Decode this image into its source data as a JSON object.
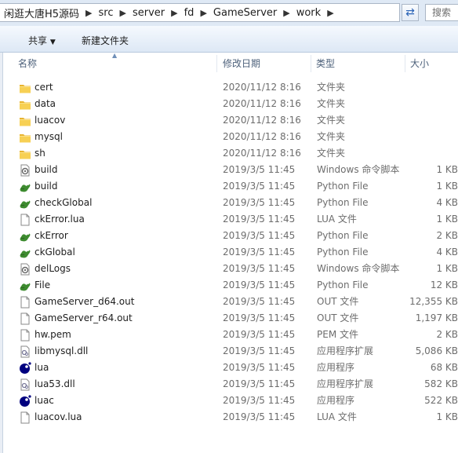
{
  "breadcrumb": [
    "闲逛大唐H5源码",
    "src",
    "server",
    "fd",
    "GameServer",
    "work"
  ],
  "search_placeholder": "搜索",
  "toolbar": {
    "share_label": "共享",
    "new_folder_label": "新建文件夹"
  },
  "columns": {
    "name": "名称",
    "date": "修改日期",
    "type": "类型",
    "size": "大小"
  },
  "files": [
    {
      "name": "cert",
      "date": "2020/11/12 8:16",
      "type": "文件夹",
      "size": "",
      "icon": "folder-icon"
    },
    {
      "name": "data",
      "date": "2020/11/12 8:16",
      "type": "文件夹",
      "size": "",
      "icon": "folder-icon"
    },
    {
      "name": "luacov",
      "date": "2020/11/12 8:16",
      "type": "文件夹",
      "size": "",
      "icon": "folder-icon"
    },
    {
      "name": "mysql",
      "date": "2020/11/12 8:16",
      "type": "文件夹",
      "size": "",
      "icon": "folder-icon"
    },
    {
      "name": "sh",
      "date": "2020/11/12 8:16",
      "type": "文件夹",
      "size": "",
      "icon": "folder-icon"
    },
    {
      "name": "build",
      "date": "2019/3/5 11:45",
      "type": "Windows 命令脚本",
      "size": "1 KB",
      "icon": "batch-file-icon"
    },
    {
      "name": "build",
      "date": "2019/3/5 11:45",
      "type": "Python File",
      "size": "1 KB",
      "icon": "python-file-icon"
    },
    {
      "name": "checkGlobal",
      "date": "2019/3/5 11:45",
      "type": "Python File",
      "size": "4 KB",
      "icon": "python-file-icon"
    },
    {
      "name": "ckError.lua",
      "date": "2019/3/5 11:45",
      "type": "LUA 文件",
      "size": "1 KB",
      "icon": "blank-file-icon"
    },
    {
      "name": "ckError",
      "date": "2019/3/5 11:45",
      "type": "Python File",
      "size": "2 KB",
      "icon": "python-file-icon"
    },
    {
      "name": "ckGlobal",
      "date": "2019/3/5 11:45",
      "type": "Python File",
      "size": "4 KB",
      "icon": "python-file-icon"
    },
    {
      "name": "delLogs",
      "date": "2019/3/5 11:45",
      "type": "Windows 命令脚本",
      "size": "1 KB",
      "icon": "batch-file-icon"
    },
    {
      "name": "File",
      "date": "2019/3/5 11:45",
      "type": "Python File",
      "size": "12 KB",
      "icon": "python-file-icon"
    },
    {
      "name": "GameServer_d64.out",
      "date": "2019/3/5 11:45",
      "type": "OUT 文件",
      "size": "12,355 KB",
      "icon": "blank-file-icon"
    },
    {
      "name": "GameServer_r64.out",
      "date": "2019/3/5 11:45",
      "type": "OUT 文件",
      "size": "1,197 KB",
      "icon": "blank-file-icon"
    },
    {
      "name": "hw.pem",
      "date": "2019/3/5 11:45",
      "type": "PEM 文件",
      "size": "2 KB",
      "icon": "blank-file-icon"
    },
    {
      "name": "libmysql.dll",
      "date": "2019/3/5 11:45",
      "type": "应用程序扩展",
      "size": "5,086 KB",
      "icon": "dll-file-icon"
    },
    {
      "name": "lua",
      "date": "2019/3/5 11:45",
      "type": "应用程序",
      "size": "68 KB",
      "icon": "lua-app-icon"
    },
    {
      "name": "lua53.dll",
      "date": "2019/3/5 11:45",
      "type": "应用程序扩展",
      "size": "582 KB",
      "icon": "dll-file-icon"
    },
    {
      "name": "luac",
      "date": "2019/3/5 11:45",
      "type": "应用程序",
      "size": "522 KB",
      "icon": "lua-app-icon"
    },
    {
      "name": "luacov.lua",
      "date": "2019/3/5 11:45",
      "type": "LUA 文件",
      "size": "1 KB",
      "icon": "blank-file-icon"
    }
  ]
}
